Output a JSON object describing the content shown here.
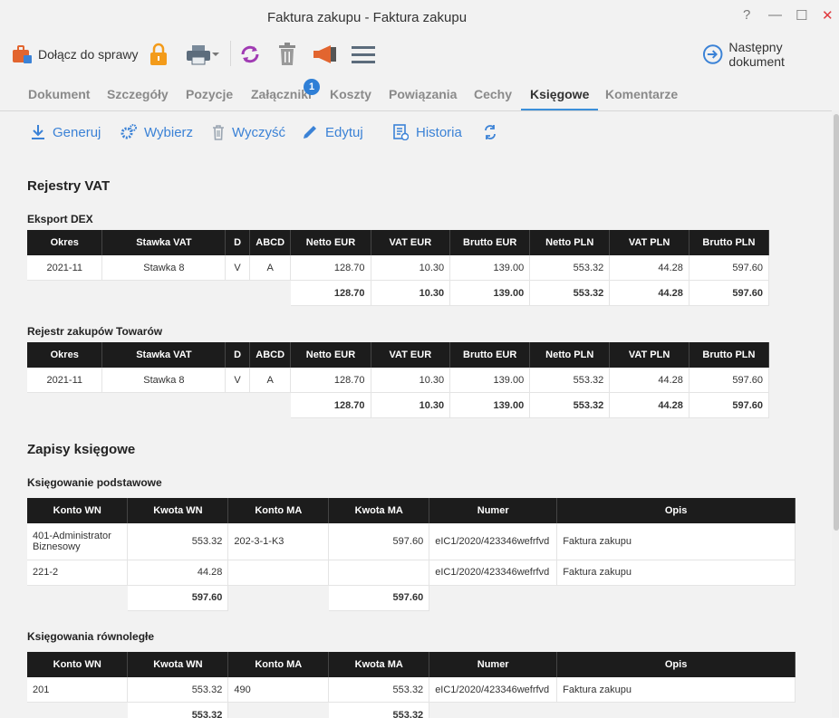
{
  "window": {
    "title": "Faktura zakupu - Faktura zakupu",
    "help": "?",
    "minimize": "—",
    "maximize": "☐",
    "close": "✕"
  },
  "toolbar": {
    "join_case": "Dołącz do sprawy",
    "next_document": "Następny dokument"
  },
  "tabs": [
    {
      "label": "Dokument"
    },
    {
      "label": "Szczegóły"
    },
    {
      "label": "Pozycje"
    },
    {
      "label": "Załączniki",
      "badge": "1"
    },
    {
      "label": "Koszty"
    },
    {
      "label": "Powiązania"
    },
    {
      "label": "Cechy"
    },
    {
      "label": "Księgowe",
      "active": true
    },
    {
      "label": "Komentarze"
    }
  ],
  "actions": {
    "generate": "Generuj",
    "choose": "Wybierz",
    "clear": "Wyczyść",
    "edit": "Edytuj",
    "history": "Historia"
  },
  "vat": {
    "title": "Rejestry VAT",
    "headers": [
      "Okres",
      "Stawka VAT",
      "D",
      "ABCD",
      "Netto EUR",
      "VAT EUR",
      "Brutto EUR",
      "Netto PLN",
      "VAT PLN",
      "Brutto PLN"
    ],
    "registers": [
      {
        "name": "Eksport DEX",
        "row": [
          "2021-11",
          "Stawka 8",
          "V",
          "A",
          "128.70",
          "10.30",
          "139.00",
          "553.32",
          "44.28",
          "597.60"
        ],
        "totals": [
          "128.70",
          "10.30",
          "139.00",
          "553.32",
          "44.28",
          "597.60"
        ]
      },
      {
        "name": "Rejestr zakupów Towarów",
        "row": [
          "2021-11",
          "Stawka 8",
          "V",
          "A",
          "128.70",
          "10.30",
          "139.00",
          "553.32",
          "44.28",
          "597.60"
        ],
        "totals": [
          "128.70",
          "10.30",
          "139.00",
          "553.32",
          "44.28",
          "597.60"
        ]
      }
    ]
  },
  "entries": {
    "title": "Zapisy księgowe",
    "headers": [
      "Konto WN",
      "Kwota WN",
      "Konto MA",
      "Kwota MA",
      "Numer",
      "Opis"
    ],
    "basic": {
      "name": "Księgowanie podstawowe",
      "rows": [
        [
          "401-Administrator Biznesowy",
          "553.32",
          "202-3-1-K3",
          "597.60",
          "eIC1/2020/423346wefrfvd",
          "Faktura zakupu"
        ],
        [
          "221-2",
          "44.28",
          "",
          "",
          "eIC1/2020/423346wefrfvd",
          "Faktura zakupu"
        ]
      ],
      "totals": [
        "597.60",
        "597.60"
      ]
    },
    "parallel": {
      "name": "Księgowania równoległe",
      "rows": [
        [
          "201",
          "553.32",
          "490",
          "553.32",
          "eIC1/2020/423346wefrfvd",
          "Faktura zakupu"
        ]
      ],
      "totals": [
        "553.32",
        "553.32"
      ]
    }
  }
}
